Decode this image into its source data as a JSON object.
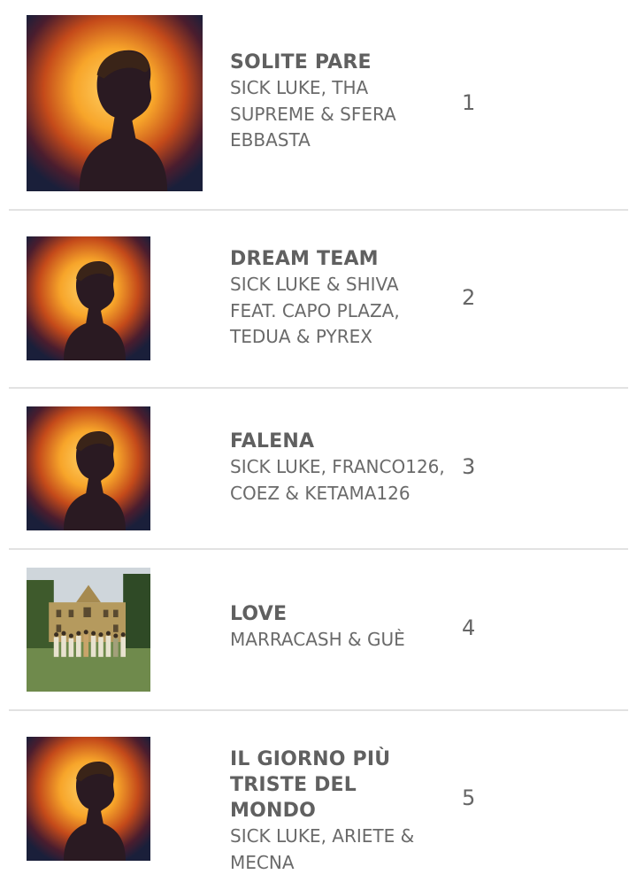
{
  "chart": {
    "rows": [
      {
        "title": "SOLITE PARE",
        "artist": "SICK LUKE, THA SUPREME & SFERA EBBASTA",
        "rank": "1",
        "cover_icon": "album-cover-portrait"
      },
      {
        "title": "DREAM TEAM",
        "artist": "SICK LUKE & SHIVA FEAT. CAPO PLAZA, TEDUA & PYREX",
        "rank": "2",
        "cover_icon": "album-cover-portrait"
      },
      {
        "title": "FALENA",
        "artist": "SICK LUKE, FRANCO126, COEZ & KETAMA126",
        "rank": "3",
        "cover_icon": "album-cover-portrait"
      },
      {
        "title": "LOVE",
        "artist": "MARRACASH & GUÈ",
        "rank": "4",
        "cover_icon": "album-cover-group-villa"
      },
      {
        "title": "IL GIORNO PIÙ TRISTE DEL MONDO",
        "artist": "SICK LUKE, ARIETE & MECNA",
        "rank": "5",
        "cover_icon": "album-cover-portrait"
      }
    ]
  },
  "colors": {
    "portrait_glow": "#f7a52a",
    "portrait_dark": "#1a1f3a",
    "divider": "#e2e2e2"
  }
}
